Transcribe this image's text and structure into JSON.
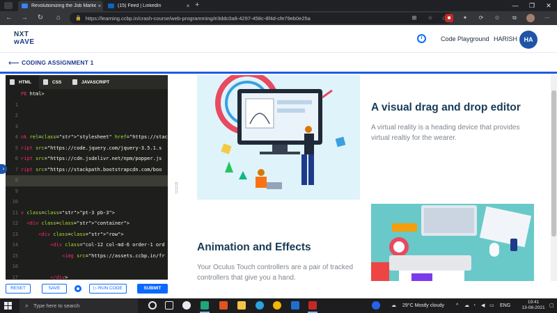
{
  "browser": {
    "tabs": [
      {
        "title": "Revolutionizing the Job Market |",
        "active": true
      },
      {
        "title": "(15) Feed | LinkedIn",
        "active": false
      }
    ],
    "new_tab": "+",
    "url": "https://learning.ccbp.in/crash-course/web-programming/e3ddc0a8-4297-458c-8f4d-cfe79eb0e25a",
    "close_glyph": "×"
  },
  "header": {
    "logo_line1": "NXT",
    "logo_line2": "wAVE",
    "code_playground": "Code Playground",
    "username": "HARISH",
    "avatar_initials": "HA"
  },
  "assignment": {
    "title": "CODING ASSIGNMENT 1"
  },
  "editor": {
    "tabs": [
      "HTML",
      "CSS",
      "JAVASCRIPT"
    ],
    "lines": [
      {
        "n": "",
        "text": "PE html>"
      },
      {
        "n": "1",
        "text": ""
      },
      {
        "n": "2",
        "text": ""
      },
      {
        "n": "3",
        "text": ""
      },
      {
        "n": "4",
        "text": "nk rel=\"stylesheet\" href=\"https://stackpath.boot"
      },
      {
        "n": "5",
        "text": "ript src=\"https://code.jquery.com/jquery-3.5.1.s"
      },
      {
        "n": "6",
        "text": "ript src=\"https://cdn.jsdelivr.net/npm/popper.js"
      },
      {
        "n": "7",
        "text": "ript src=\"https://stackpath.bootstrapcdn.com/boo"
      },
      {
        "n": "8",
        "text": ""
      },
      {
        "n": "9",
        "text": ""
      },
      {
        "n": "10",
        "text": ""
      },
      {
        "n": "11",
        "text": "v class=\"pt-3 pb-3\">"
      },
      {
        "n": "12",
        "text": "  <div class=\"container\">"
      },
      {
        "n": "13",
        "text": "      <div class=\"row\">"
      },
      {
        "n": "14",
        "text": "          <div class=\"col-12 col-md-6 order-1 ord"
      },
      {
        "n": "15",
        "text": "              <img src=\"https://assets.ccbp.in/fr"
      },
      {
        "n": "16",
        "text": ""
      },
      {
        "n": "17",
        "text": "          </div>"
      }
    ]
  },
  "actions": {
    "reset": "RESET",
    "save": "SAVE",
    "run_code": "▷ RUN CODE",
    "submit": "SUBMIT"
  },
  "preview": {
    "section1_heading": "A visual drag and drop editor",
    "section1_text": "A virtual reality is a heading device that provides virtual realtiy for the wearer.",
    "section2_heading": "Animation and Effects",
    "section2_text": "Your Oculus Touch controllers are a pair of tracked controllers that give you a hand."
  },
  "taskbar": {
    "search_placeholder": "Type here to search",
    "weather": "29°C  Mostly cloudy",
    "language": "ENG",
    "time": "19:41",
    "date": "13-08-2021"
  },
  "colors": {
    "accent": "#0b69ff",
    "brand_navy": "#1e3a8a",
    "editor_bg": "#1e1f1c"
  }
}
